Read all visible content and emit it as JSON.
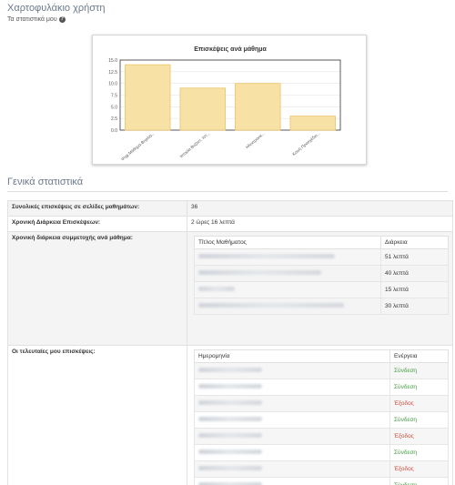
{
  "header": {
    "title": "Χαρτοφυλάκιο χρήστη",
    "subtitle": "Τα στατιστικά μου",
    "help_icon": "question-circle-icon"
  },
  "chart_data": {
    "type": "bar",
    "title": "Επισκέψεις ανά μάθημα",
    "categories": [
      "Ψηφ.Μάθημα-Βιτρίνα...",
      "Ιστορία Βυζαντ. Ιστ...",
      "Ηλεκτρονικ...",
      "Κοινή Προσχέδιο..."
    ],
    "values": [
      14,
      9,
      10,
      3
    ],
    "yticks": [
      "0.0",
      "2.5",
      "5.0",
      "7.5",
      "10.0",
      "12.5",
      "15.0"
    ],
    "ylim": [
      0,
      15
    ],
    "colors": {
      "bar_fill": "#f7e1a4",
      "bar_stroke": "#e9c46a"
    }
  },
  "general": {
    "section_title": "Γενικά στατιστικά",
    "rows": [
      {
        "label": "Συνολικές επισκέψεις σε σελίδες μαθημάτων:",
        "value": "36"
      },
      {
        "label": "Χρονική Διάρκεια Επισκέψεων:",
        "value": "2 ώρες 16 λεπτά"
      },
      {
        "label": "Χρονική διάρκεια συμμετοχής ανά μάθημα:"
      },
      {
        "label": "Οι τελευταίες μου επισκέψεις:"
      }
    ],
    "durations": {
      "col_course": "Τίτλος Μαθήματος",
      "col_duration": "Διάρκεια",
      "rows": [
        {
          "duration": "51 λεπτά"
        },
        {
          "duration": "40 λεπτά"
        },
        {
          "duration": "15 λεπτά"
        },
        {
          "duration": "30 λεπτά"
        }
      ]
    },
    "visits": {
      "col_date": "Ημερομηνία",
      "col_action": "Ενέργεια",
      "rows": [
        {
          "action": "Σύνδεση",
          "type": "in"
        },
        {
          "action": "Σύνδεση",
          "type": "in"
        },
        {
          "action": "Έξοδος",
          "type": "out"
        },
        {
          "action": "Σύνδεση",
          "type": "in"
        },
        {
          "action": "Έξοδος",
          "type": "out"
        },
        {
          "action": "Σύνδεση",
          "type": "in"
        },
        {
          "action": "Έξοδος",
          "type": "out"
        },
        {
          "action": "Σύνδεση",
          "type": "in"
        }
      ]
    }
  }
}
